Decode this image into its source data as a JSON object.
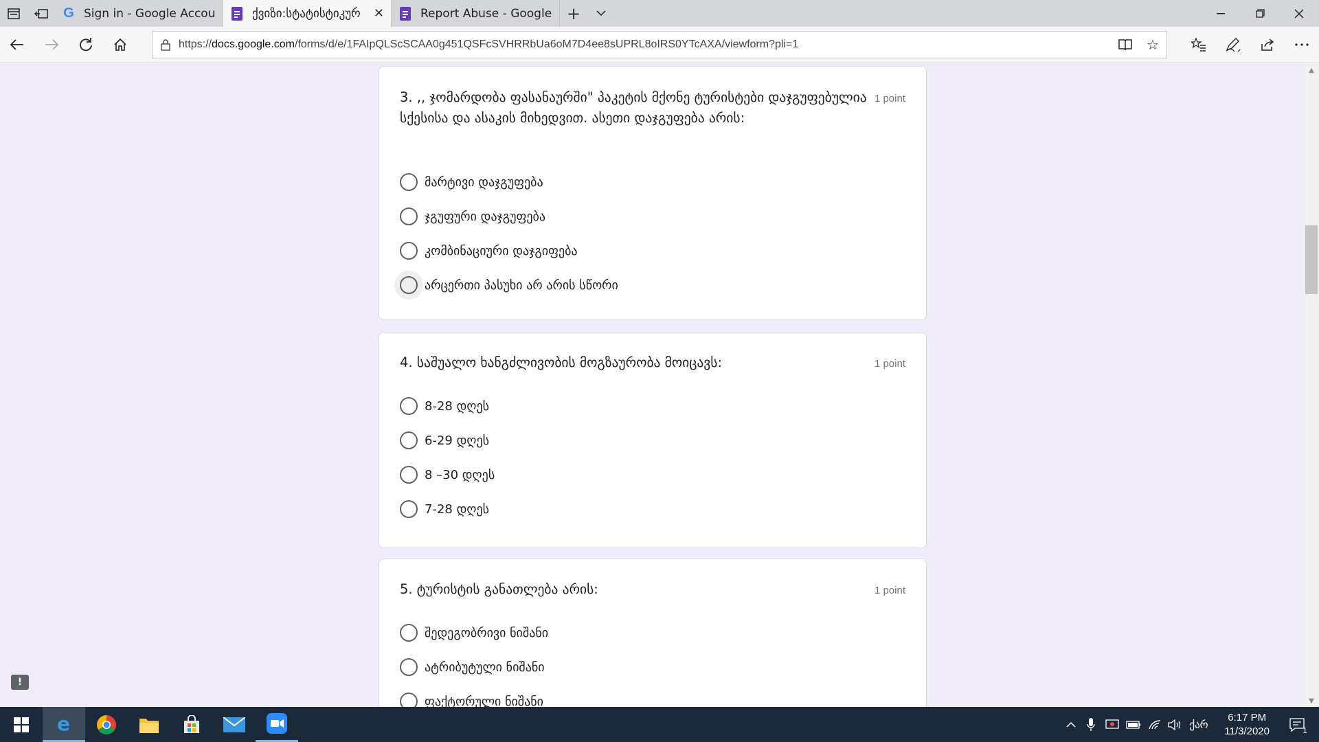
{
  "browser": {
    "tabs": [
      {
        "title": "Sign in - Google Accounts",
        "icon": "google-icon",
        "active": false
      },
      {
        "title": "ქვიზი:სტატისტიკურ",
        "icon": "forms-icon",
        "active": true
      },
      {
        "title": "Report Abuse - Google Forr",
        "icon": "forms-icon",
        "active": false
      }
    ],
    "url_prefix": "https://",
    "url_domain": "docs.google.com",
    "url_path": "/forms/d/e/1FAIpQLScSCAA0g451QSFcSVHRRbUa6oM7D4ee8sUPRL8oIRS0YTcAXA/viewform?pli=1"
  },
  "questions": [
    {
      "title": "3. ,, ჯომარდობა ფასანაურში\" პაკეტის მქონე ტურისტები დაჯგუფებულია სქესისა და ასაკის მიხედვით. ასეთი დაჯგუფება არის:",
      "points": "1 point",
      "options": [
        "მარტივი დაჯგუფება",
        "ჯგუფური დაჯგუფება",
        "კომბინაციური დაჯგიფება",
        "არცერთი პასუხი არ არის სწორი"
      ]
    },
    {
      "title": "4. საშუალო ხანგძლივობის მოგზაურობა მოიცავს:",
      "points": "1 point",
      "options": [
        "8-28 დღეს",
        "6-29 დღეს",
        "8 –30 დღეს",
        "7-28 დღეს"
      ]
    },
    {
      "title": "5. ტურისტის განათლება არის:",
      "points": "1 point",
      "options": [
        "შედეგობრივი ნიშანი",
        "ატრიბუტული ნიშანი",
        "ფაქტორული ნიშანი"
      ]
    }
  ],
  "taskbar": {
    "time": "6:17 PM",
    "date": "11/3/2020",
    "language": "ქარ",
    "notification_count": "1"
  },
  "colors": {
    "page_background": "#f0ebf8",
    "forms_accent": "#673ab7",
    "taskbar": "#1b2a3a"
  }
}
